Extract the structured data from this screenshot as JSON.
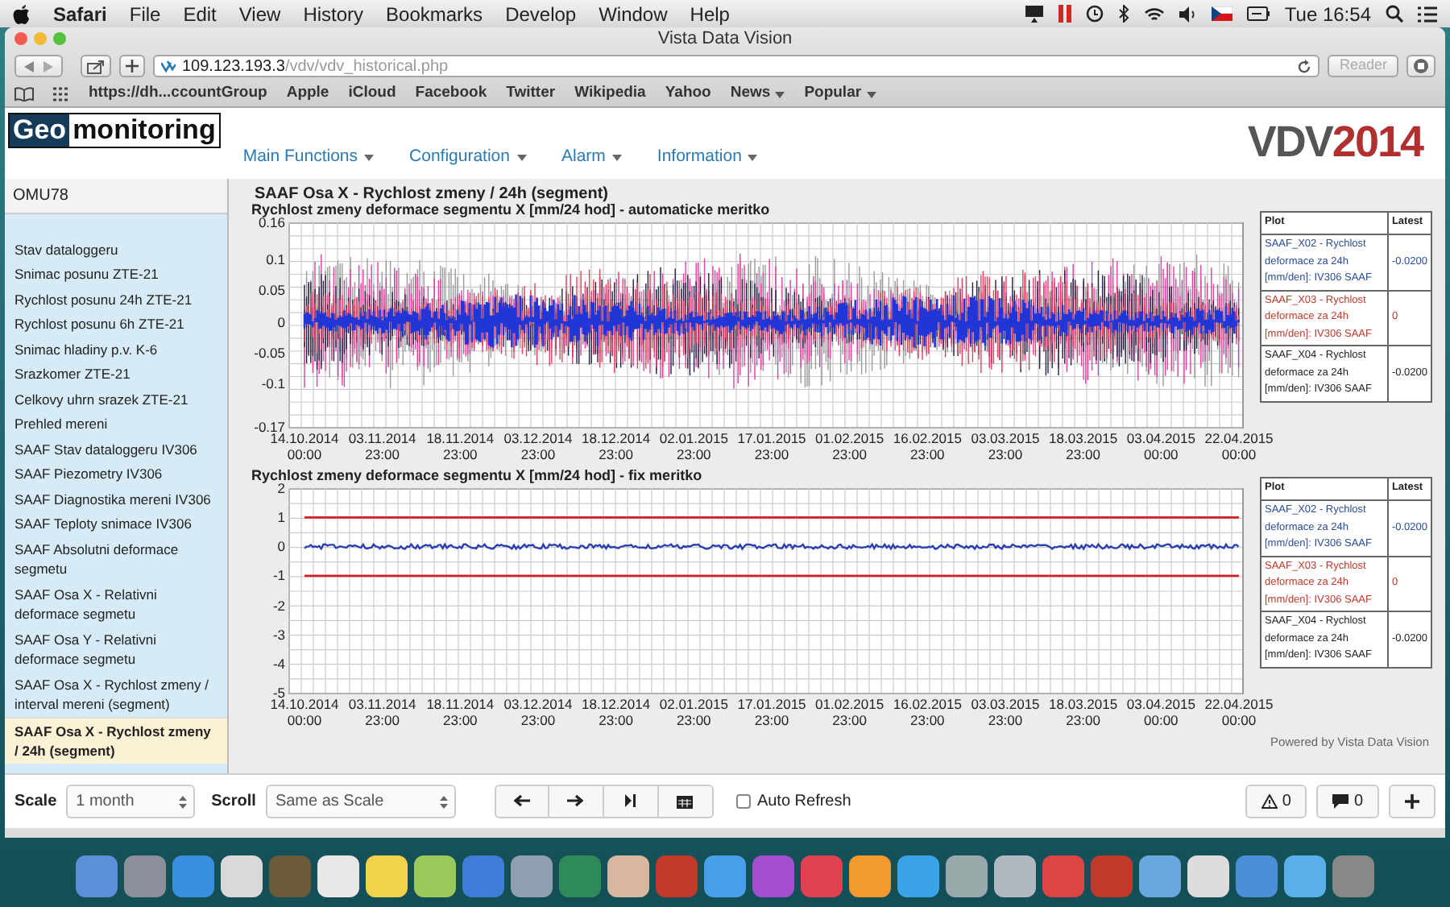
{
  "menubar": {
    "app": "Safari",
    "menus": [
      "File",
      "Edit",
      "View",
      "History",
      "Bookmarks",
      "Develop",
      "Window",
      "Help"
    ],
    "clock": "Tue 16:54"
  },
  "browser": {
    "title": "Vista Data Vision",
    "url_host": "109.123.193.3",
    "url_path": "/vdv/vdv_historical.php",
    "reader": "Reader",
    "bookmarks": [
      {
        "label": "https://dh...ccountGroup",
        "dropdown": false
      },
      {
        "label": "Apple",
        "dropdown": false
      },
      {
        "label": "iCloud",
        "dropdown": false
      },
      {
        "label": "Facebook",
        "dropdown": false
      },
      {
        "label": "Twitter",
        "dropdown": false
      },
      {
        "label": "Wikipedia",
        "dropdown": false
      },
      {
        "label": "Yahoo",
        "dropdown": false
      },
      {
        "label": "News",
        "dropdown": true
      },
      {
        "label": "Popular",
        "dropdown": true
      }
    ]
  },
  "header": {
    "logo_a": "Geo",
    "logo_b": "monitoring",
    "nav": [
      "Main Functions",
      "Configuration",
      "Alarm",
      "Information"
    ],
    "brand_a": "VDV",
    "brand_b": "2014"
  },
  "sidebar": {
    "group": "OMU78",
    "items": [
      {
        "label": "Stav dataloggeru",
        "selected": false
      },
      {
        "label": "Snimac posunu ZTE-21",
        "selected": false
      },
      {
        "label": "Rychlost posunu 24h ZTE-21",
        "selected": false
      },
      {
        "label": "Rychlost posunu 6h ZTE-21",
        "selected": false
      },
      {
        "label": "Snimac hladiny p.v. K-6",
        "selected": false
      },
      {
        "label": "Srazkomer ZTE-21",
        "selected": false
      },
      {
        "label": "Celkovy uhrn srazek ZTE-21",
        "selected": false
      },
      {
        "label": "Prehled mereni",
        "selected": false
      },
      {
        "label": "SAAF Stav dataloggeru IV306",
        "selected": false
      },
      {
        "label": "SAAF Piezometry IV306",
        "selected": false
      },
      {
        "label": "SAAF Diagnostika mereni IV306",
        "selected": false
      },
      {
        "label": "SAAF Teploty snimace IV306",
        "selected": false
      },
      {
        "label": "SAAF Absolutni deformace segmetu",
        "selected": false
      },
      {
        "label": "SAAF Osa X - Relativni deformace segmetu",
        "selected": false
      },
      {
        "label": "SAAF Osa Y - Relativni deformace segmetu",
        "selected": false
      },
      {
        "label": "SAAF Osa X - Rychlost zmeny / interval mereni (segment)",
        "selected": false
      },
      {
        "label": "SAAF Osa X - Rychlost zmeny / 24h (segment)",
        "selected": true
      }
    ]
  },
  "page_title": "SAAF Osa X - Rychlost zmeny / 24h (segment)",
  "charts": [
    {
      "kind": "auto",
      "title": "Rychlost zmeny deformace segmentu X [mm/24 hod] -  automaticke meritko",
      "y_labels": [
        "0.16",
        "0.1",
        "0.05",
        "0",
        "-0.05",
        "-0.1",
        "-0.17"
      ],
      "x_labels": [
        {
          "date": "14.10.2014",
          "time": "00:00"
        },
        {
          "date": "03.11.2014",
          "time": "23:00"
        },
        {
          "date": "18.11.2014",
          "time": "23:00"
        },
        {
          "date": "03.12.2014",
          "time": "23:00"
        },
        {
          "date": "18.12.2014",
          "time": "23:00"
        },
        {
          "date": "02.01.2015",
          "time": "23:00"
        },
        {
          "date": "17.01.2015",
          "time": "23:00"
        },
        {
          "date": "01.02.2015",
          "time": "23:00"
        },
        {
          "date": "16.02.2015",
          "time": "23:00"
        },
        {
          "date": "03.03.2015",
          "time": "23:00"
        },
        {
          "date": "18.03.2015",
          "time": "23:00"
        },
        {
          "date": "03.04.2015",
          "time": "00:00"
        },
        {
          "date": "22.04.2015",
          "time": "00:00"
        }
      ],
      "legend": {
        "columns": [
          "Plot",
          "Latest"
        ],
        "rows": [
          {
            "plot": "SAAF_X02 - Rychlost deformace za 24h [mm/den]: IV306 SAAF",
            "latest": "-0.0200",
            "color": "#2b4c9b"
          },
          {
            "plot": "SAAF_X03 - Rychlost deformace za 24h [mm/den]: IV306 SAAF",
            "latest": "0",
            "color": "#c0392b"
          },
          {
            "plot": "SAAF_X04 - Rychlost deformace za 24h [mm/den]: IV306 SAAF",
            "latest": "-0.0200",
            "color": "#222222"
          }
        ]
      }
    },
    {
      "kind": "fixed",
      "title": "Rychlost zmeny deformace segmentu X [mm/24 hod] - fix meritko",
      "y_labels": [
        "2",
        "1",
        "0",
        "-1",
        "-2",
        "-3",
        "-4",
        "-5"
      ],
      "x_labels": [
        {
          "date": "14.10.2014",
          "time": "00:00"
        },
        {
          "date": "03.11.2014",
          "time": "23:00"
        },
        {
          "date": "18.11.2014",
          "time": "23:00"
        },
        {
          "date": "03.12.2014",
          "time": "23:00"
        },
        {
          "date": "18.12.2014",
          "time": "23:00"
        },
        {
          "date": "02.01.2015",
          "time": "23:00"
        },
        {
          "date": "17.01.2015",
          "time": "23:00"
        },
        {
          "date": "01.02.2015",
          "time": "23:00"
        },
        {
          "date": "16.02.2015",
          "time": "23:00"
        },
        {
          "date": "03.03.2015",
          "time": "23:00"
        },
        {
          "date": "18.03.2015",
          "time": "23:00"
        },
        {
          "date": "03.04.2015",
          "time": "00:00"
        },
        {
          "date": "22.04.2015",
          "time": "00:00"
        }
      ],
      "legend": {
        "columns": [
          "Plot",
          "Latest"
        ],
        "rows": [
          {
            "plot": "SAAF_X02 - Rychlost deformace za 24h [mm/den]: IV306 SAAF",
            "latest": "-0.0200",
            "color": "#2b4c9b"
          },
          {
            "plot": "SAAF_X03 - Rychlost deformace za 24h [mm/den]: IV306 SAAF",
            "latest": "0",
            "color": "#c0392b"
          },
          {
            "plot": "SAAF_X04 - Rychlost deformace za 24h [mm/den]: IV306 SAAF",
            "latest": "-0.0200",
            "color": "#222222"
          }
        ]
      }
    }
  ],
  "powered": "Powered by Vista Data Vision",
  "toolbar": {
    "scale_label": "Scale",
    "scale_value": "1 month",
    "scroll_label": "Scroll",
    "scroll_value": "Same as Scale",
    "auto_refresh": {
      "label": "Auto Refresh",
      "checked": false
    },
    "alerts": "0",
    "comments": "0"
  }
}
